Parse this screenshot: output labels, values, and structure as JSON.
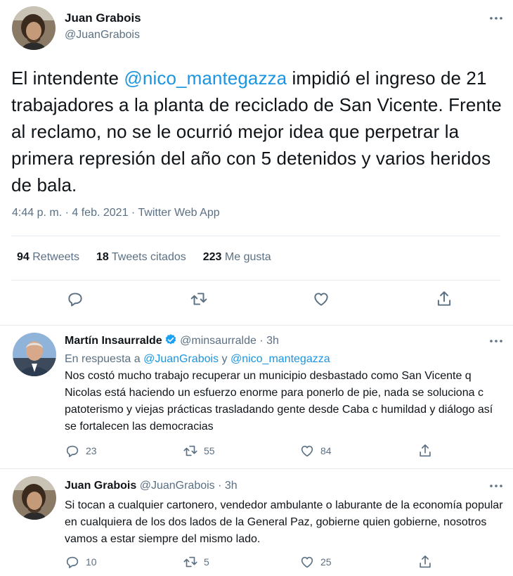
{
  "main_tweet": {
    "author_name": "Juan Grabois",
    "author_handle": "@JuanGrabois",
    "text_part1": "El intendente ",
    "mention": "@nico_mantegazza",
    "text_part2": " impidió el ingreso de 21 trabajadores a la planta de reciclado de San Vicente. Frente al reclamo, no se le ocurrió mejor idea que perpetrar la primera represión del año con 5 detenidos y varios heridos de bala.",
    "time": "4:44 p. m.",
    "date": "4 feb. 2021",
    "source": "Twitter Web App",
    "separator": "·",
    "stats": {
      "retweets_count": "94",
      "retweets_label": "Retweets",
      "quotes_count": "18",
      "quotes_label": "Tweets citados",
      "likes_count": "223",
      "likes_label": "Me gusta"
    }
  },
  "replies": [
    {
      "author_name": "Martín Insaurralde",
      "author_handle": "@minsaurralde",
      "time": "3h",
      "replying_prefix": "En respuesta a",
      "replying_to_1": "@JuanGrabois",
      "replying_and": "y",
      "replying_to_2": "@nico_mantegazza",
      "text": "Nos costó mucho trabajo recuperar un municipio desbastado como San Vicente q Nicolas está haciendo un esfuerzo enorme para ponerlo de pie, nada se soluciona c patoterismo y viejas prácticas trasladando gente desde Caba  c humildad y diálogo así se fortalecen las democracias",
      "replies_count": "23",
      "retweets_count": "55",
      "likes_count": "84"
    },
    {
      "author_name": "Juan Grabois",
      "author_handle": "@JuanGrabois",
      "time": "3h",
      "text": "Si tocan a cualquier cartonero, vendedor ambulante o laburante de la economía popular en cualquiera de los dos lados de la General Paz, gobierne quien gobierne, nosotros vamos a estar siempre del mismo lado.",
      "replies_count": "10",
      "retweets_count": "5",
      "likes_count": "25"
    }
  ],
  "colors": {
    "link": "#1b95e0",
    "muted": "#5b7083",
    "text": "#0f1419",
    "verified": "#1da1f2"
  },
  "icons": [
    "more-icon",
    "reply-icon",
    "retweet-icon",
    "like-icon",
    "share-icon",
    "verified-icon"
  ]
}
